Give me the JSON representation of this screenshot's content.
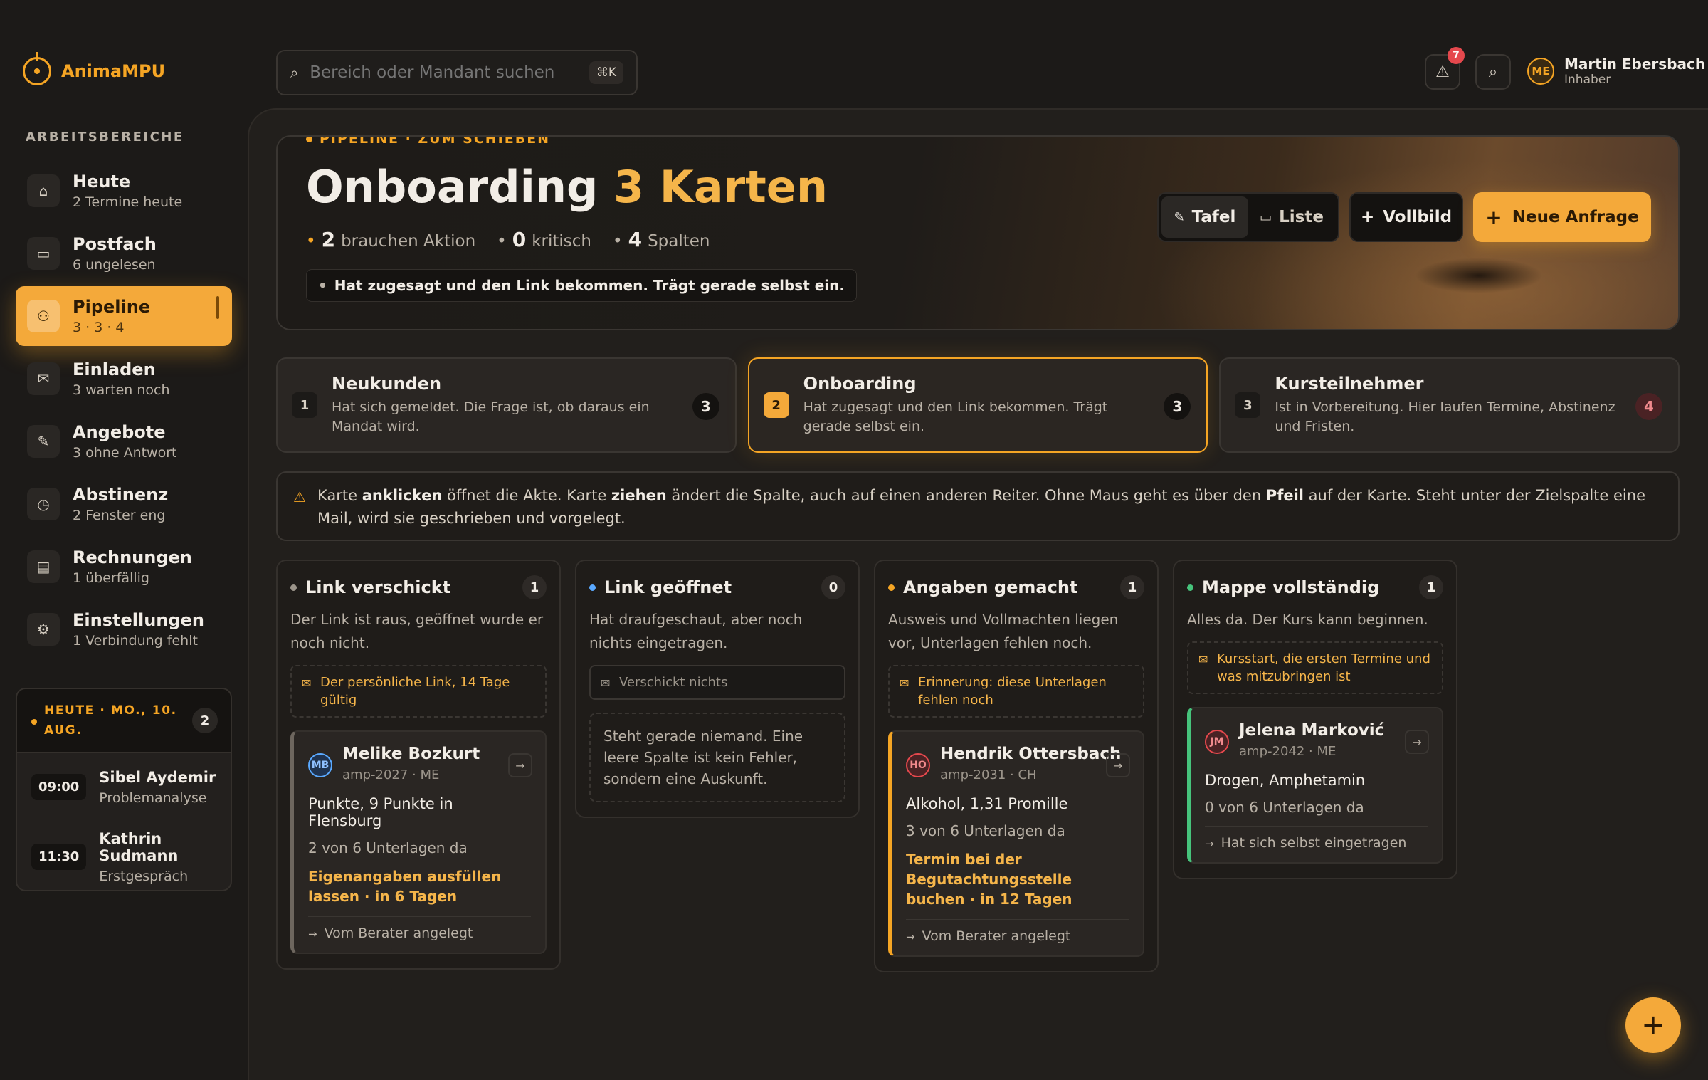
{
  "app": {
    "name": "AnimaMPU"
  },
  "search": {
    "placeholder": "Bereich oder Mandant suchen",
    "shortcut": "⌘K"
  },
  "header": {
    "notif_count": "7"
  },
  "user": {
    "initials": "ME",
    "name": "Martin Ebersbach",
    "role": "Inhaber"
  },
  "sidebar": {
    "section_label": "ARBEITSBEREICHE",
    "items": [
      {
        "title": "Heute",
        "sub": "2 Termine heute",
        "icon": "home-icon"
      },
      {
        "title": "Postfach",
        "sub": "6 ungelesen",
        "icon": "inbox-icon"
      },
      {
        "title": "Pipeline",
        "sub": "3 · 3 · 4",
        "icon": "users-icon"
      },
      {
        "title": "Einladen",
        "sub": "3 warten noch",
        "icon": "mail-icon"
      },
      {
        "title": "Angebote",
        "sub": "3 ohne Antwort",
        "icon": "pen-icon"
      },
      {
        "title": "Abstinenz",
        "sub": "2 Fenster eng",
        "icon": "clock-icon"
      },
      {
        "title": "Rechnungen",
        "sub": "1 überfällig",
        "icon": "folder-icon"
      },
      {
        "title": "Einstellungen",
        "sub": "1 Verbindung fehlt",
        "icon": "gear-icon"
      }
    ]
  },
  "today": {
    "label": "HEUTE · MO., 10. AUG.",
    "count": "2",
    "appointments": [
      {
        "time": "09:00",
        "name": "Sibel Aydemir",
        "type": "Problemanalyse"
      },
      {
        "time": "11:30",
        "name": "Kathrin Sudmann",
        "type": "Erstgespräch"
      }
    ]
  },
  "hero": {
    "eyebrow": "PIPELINE · ZUM SCHIEBEN",
    "title": "Onboarding",
    "title_accent": "3 Karten",
    "stats": [
      {
        "value": "2",
        "label": "brauchen Aktion"
      },
      {
        "value": "0",
        "label": "kritisch"
      },
      {
        "value": "4",
        "label": "Spalten"
      }
    ],
    "note": "Hat zugesagt und den Link bekommen. Trägt gerade selbst ein.",
    "view_tafel": "Tafel",
    "view_liste": "Liste",
    "vollbild": "Vollbild",
    "neue_anfrage": "Neue Anfrage"
  },
  "stages": [
    {
      "num": "1",
      "title": "Neukunden",
      "desc": "Hat sich gemeldet. Die Frage ist, ob daraus ein Mandat wird.",
      "count": "3"
    },
    {
      "num": "2",
      "title": "Onboarding",
      "desc": "Hat zugesagt und den Link bekommen. Trägt gerade selbst ein.",
      "count": "3"
    },
    {
      "num": "3",
      "title": "Kursteilnehmer",
      "desc": "Ist in Vorbereitung. Hier laufen Termine, Abstinenz und Fristen.",
      "count": "4"
    }
  ],
  "hint": {
    "p1": "Karte ",
    "b1": "anklicken",
    "p2": " öffnet die Akte. Karte ",
    "b2": "ziehen",
    "p3": " ändert die Spalte, auch auf einen anderen Reiter. Ohne Maus geht es über den ",
    "b3": "Pfeil",
    "p4": " auf der Karte. Steht unter der Zielspalte eine Mail, wird sie geschrieben und vorgelegt."
  },
  "columns": [
    {
      "title": "Link verschickt",
      "count": "1",
      "dot": "#9b948a",
      "desc": "Der Link ist raus, geöffnet wurde er noch nicht.",
      "mail": "Der persönliche Link, 14 Tage gültig",
      "card": {
        "initials": "MB",
        "name": "Melike Bozkurt",
        "id": "amp-2027 · ME",
        "line": "Punkte, 9 Punkte in Flensburg",
        "docs": "2 von 6 Unterlagen da",
        "task": "Eigenangaben ausfüllen lassen · in 6 Tagen",
        "foot": "Vom Berater angelegt"
      }
    },
    {
      "title": "Link geöffnet",
      "count": "0",
      "dot": "#5aa9ff",
      "desc": "Hat draufgeschaut, aber noch nichts eingetragen.",
      "mail": "Verschickt nichts",
      "empty": "Steht gerade niemand. Eine leere Spalte ist kein Fehler, sondern eine Auskunft."
    },
    {
      "title": "Angaben gemacht",
      "count": "1",
      "dot": "#f5a524",
      "desc": "Ausweis und Vollmachten liegen vor, Unterlagen fehlen noch.",
      "mail": "Erinnerung: diese Unterlagen fehlen noch",
      "card": {
        "initials": "HO",
        "name": "Hendrik Ottersbach",
        "id": "amp-2031 · CH",
        "line": "Alkohol, 1,31 Promille",
        "docs": "3 von 6 Unterlagen da",
        "task": "Termin bei der Begutachtungsstelle buchen · in 12 Tagen",
        "foot": "Vom Berater angelegt"
      }
    },
    {
      "title": "Mappe vollständig",
      "count": "1",
      "dot": "#46c37b",
      "desc": "Alles da. Der Kurs kann beginnen.",
      "mail": "Kursstart, die ersten Termine und was mitzubringen ist",
      "card": {
        "initials": "JM",
        "name": "Jelena Marković",
        "id": "amp-2042 · ME",
        "line": "Drogen, Amphetamin",
        "docs": "0 von 6 Unterlagen da",
        "foot": "Hat sich selbst eingetragen"
      }
    }
  ],
  "colors": {
    "accent": "#f5a524",
    "background": "#1c1a18",
    "danger": "#e5484d",
    "success": "#46c37b"
  }
}
